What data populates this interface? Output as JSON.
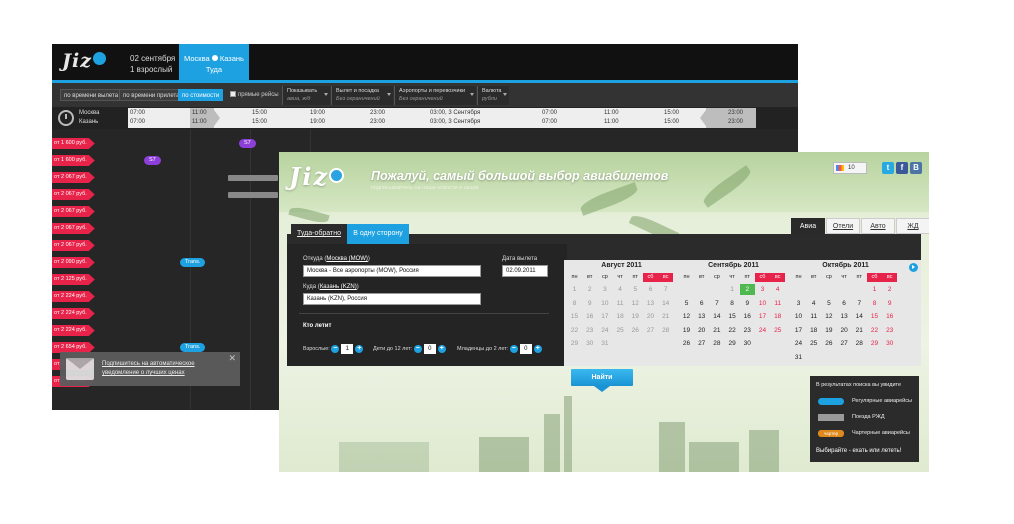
{
  "back": {
    "logo": "Jiz",
    "date": "02 сентября",
    "pax": "1 взрослый",
    "route_from": "Москва",
    "route_to": "Казань",
    "direction": "Туда",
    "filters": {
      "by_departure": "по времени вылета",
      "by_arrival": "по времени прилета",
      "by_price": "по стоимости",
      "direct": "прямые рейсы",
      "show_label": "Показывать",
      "show_value": "авиа, ж/д",
      "flights_label": "Вылет и посадка",
      "flights_value": "Без ограничений",
      "airports_label": "Аэропорты и перевозчики",
      "airports_value": "Без ограничений",
      "currency_label": "Валюта",
      "currency_value": "рубли"
    },
    "cities": {
      "from": "Москва",
      "to": "Казань"
    },
    "time_labels": {
      "t0700": "07:00",
      "t1100": "11:00",
      "t1500": "15:00",
      "t1900": "19:00",
      "t2300": "23:00",
      "t0300": "03:00, 3 Сентября"
    },
    "prices": [
      "от 1 600 руб.",
      "от 1 600 руб.",
      "от 2 067 руб.",
      "от 2 067 руб.",
      "от 2 067 руб.",
      "от 2 067 руб.",
      "от 2 067 руб.",
      "от 2 090 руб.",
      "от 2 125 руб.",
      "от 2 224 руб.",
      "от 2 224 руб.",
      "от 2 224 руб.",
      "от 2 654 руб.",
      "от 2 674 руб.",
      "от 2 674 руб."
    ],
    "chips": {
      "s7a": "S7",
      "s7b": "S7",
      "trans1": "Trans.",
      "trans2": "Trans."
    },
    "notify": {
      "line1": "Подпишитесь на автоматическое",
      "line2": "уведомление о лучших ценах",
      "close": "✕"
    }
  },
  "front": {
    "logo": "Jiz",
    "slogan": "Пожалуй, самый большой выбор авиабилетов",
    "subtitle": "подписывайтесь на наши новости и акции",
    "social_count": "10",
    "social": {
      "twitter": "t",
      "facebook": "f",
      "vk": "B"
    },
    "right_tabs": {
      "avia": "Авиа",
      "hotels": "Отели",
      "auto": "Авто",
      "rail": "ЖД"
    },
    "tabs": {
      "round": "Туда-обратно",
      "oneway": "В одну сторону"
    },
    "form": {
      "from_label": "Откуда (",
      "from_link": "Москва (MOW)",
      "from_close": ")",
      "from_value": "Москва - Все аэропорты (MOW), Россия",
      "to_label": "Куда (",
      "to_link": "Казань (KZN)",
      "to_close": ")",
      "to_value": "Казань (KZN), Россия",
      "date_label": "Дата вылета",
      "date_value": "02.09.2011",
      "who": "Кто летит",
      "adults_label": "Взрослые:",
      "adults_value": "1",
      "children_label": "Дети до 12 лет:",
      "children_value": "0",
      "infants_label": "Младенцы до 2 лет:",
      "infants_value": "0",
      "minus": "−",
      "plus": "+"
    },
    "calendar": {
      "weekdays": [
        "пн",
        "вт",
        "ср",
        "чт",
        "пт",
        "сб",
        "вс"
      ],
      "months": [
        {
          "title": "Август 2011",
          "offset": 0,
          "days": 31,
          "past_until": 31,
          "selected": 0
        },
        {
          "title": "Сентябрь 2011",
          "offset": 3,
          "days": 30,
          "past_until": 1,
          "selected": 2
        },
        {
          "title": "Октябрь 2011",
          "offset": 5,
          "days": 31,
          "past_until": 0,
          "selected": 0
        }
      ]
    },
    "find": "Найти",
    "legend": {
      "title": "В результатах поиска вы увидите",
      "regular": "Регулярные авиарейсы",
      "rail": "Поезда РЖД",
      "charter": "Чартерные авиарейсы",
      "charter_tag": "чартер",
      "bottom": "Выбирайте - ехать или лететь!"
    },
    "colors": {
      "accent": "#1ea1e0",
      "weekend": "#e8234a",
      "selected": "#4fb84f"
    }
  }
}
